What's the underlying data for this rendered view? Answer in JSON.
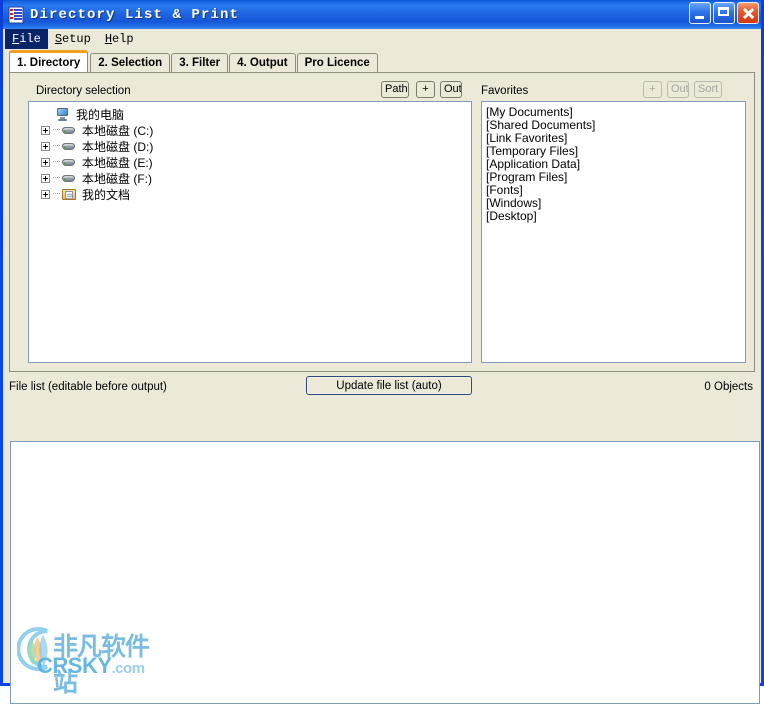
{
  "window": {
    "title": "Directory List & Print",
    "icon": "list-document-icon",
    "controls": {
      "minimize": "minimize-button",
      "maximize": "maximize-button",
      "close": "close-button"
    }
  },
  "menu": {
    "items": [
      {
        "label": "File",
        "mnemonic": "F",
        "active": true
      },
      {
        "label": "Setup",
        "mnemonic": "S",
        "active": false
      },
      {
        "label": "Help",
        "mnemonic": "H",
        "active": false
      }
    ]
  },
  "tabs": [
    {
      "label": "1. Directory",
      "active": true
    },
    {
      "label": "2. Selection",
      "active": false
    },
    {
      "label": "3. Filter",
      "active": false
    },
    {
      "label": "4. Output",
      "active": false
    },
    {
      "label": "Pro Licence",
      "active": false
    }
  ],
  "directory_panel": {
    "label": "Directory selection",
    "buttons": [
      {
        "label": "Path",
        "name": "path-button",
        "disabled": false
      },
      {
        "label": "+",
        "name": "add-path-button",
        "disabled": false
      },
      {
        "label": "Out",
        "name": "out-path-button",
        "disabled": false
      }
    ],
    "tree": [
      {
        "label": "我的电脑",
        "icon": "monitor-icon",
        "indent": 0,
        "expandable": false
      },
      {
        "label": "本地磁盘 (C:)",
        "icon": "disk-icon",
        "indent": 1,
        "expandable": true
      },
      {
        "label": "本地磁盘 (D:)",
        "icon": "disk-icon",
        "indent": 1,
        "expandable": true
      },
      {
        "label": "本地磁盘 (E:)",
        "icon": "disk-icon",
        "indent": 1,
        "expandable": true
      },
      {
        "label": "本地磁盘 (F:)",
        "icon": "disk-icon",
        "indent": 1,
        "expandable": true
      },
      {
        "label": "我的文档",
        "icon": "documents-folder-icon",
        "indent": 1,
        "expandable": true
      }
    ]
  },
  "favorites_panel": {
    "label": "Favorites",
    "buttons": [
      {
        "label": "+",
        "name": "add-favorite-button",
        "disabled": true
      },
      {
        "label": "Out",
        "name": "out-favorite-button",
        "disabled": true
      },
      {
        "label": "Sort",
        "name": "sort-favorites-button",
        "disabled": true
      }
    ],
    "items": [
      "[My Documents]",
      "[Shared Documents]",
      "[Link Favorites]",
      "[Temporary Files]",
      "[Application Data]",
      "[Program Files]",
      "[Fonts]",
      "[Windows]",
      "[Desktop]"
    ]
  },
  "file_list": {
    "label": "File list (editable before output)",
    "update_button": "Update file list (auto)",
    "object_count": "0 Objects",
    "content": ""
  },
  "watermark": {
    "chinese": "非凡软件站",
    "site": "CRSKY",
    "tld": ".com"
  },
  "colors": {
    "titlebar_blue": "#1e63e2",
    "frame_blue": "#0a46e3",
    "client_beige": "#ece9d8",
    "active_tab_accent": "#f0a020",
    "menu_highlight": "#0a246a",
    "listbox_border": "#7f9db9",
    "close_button_red": "#e8592a"
  }
}
